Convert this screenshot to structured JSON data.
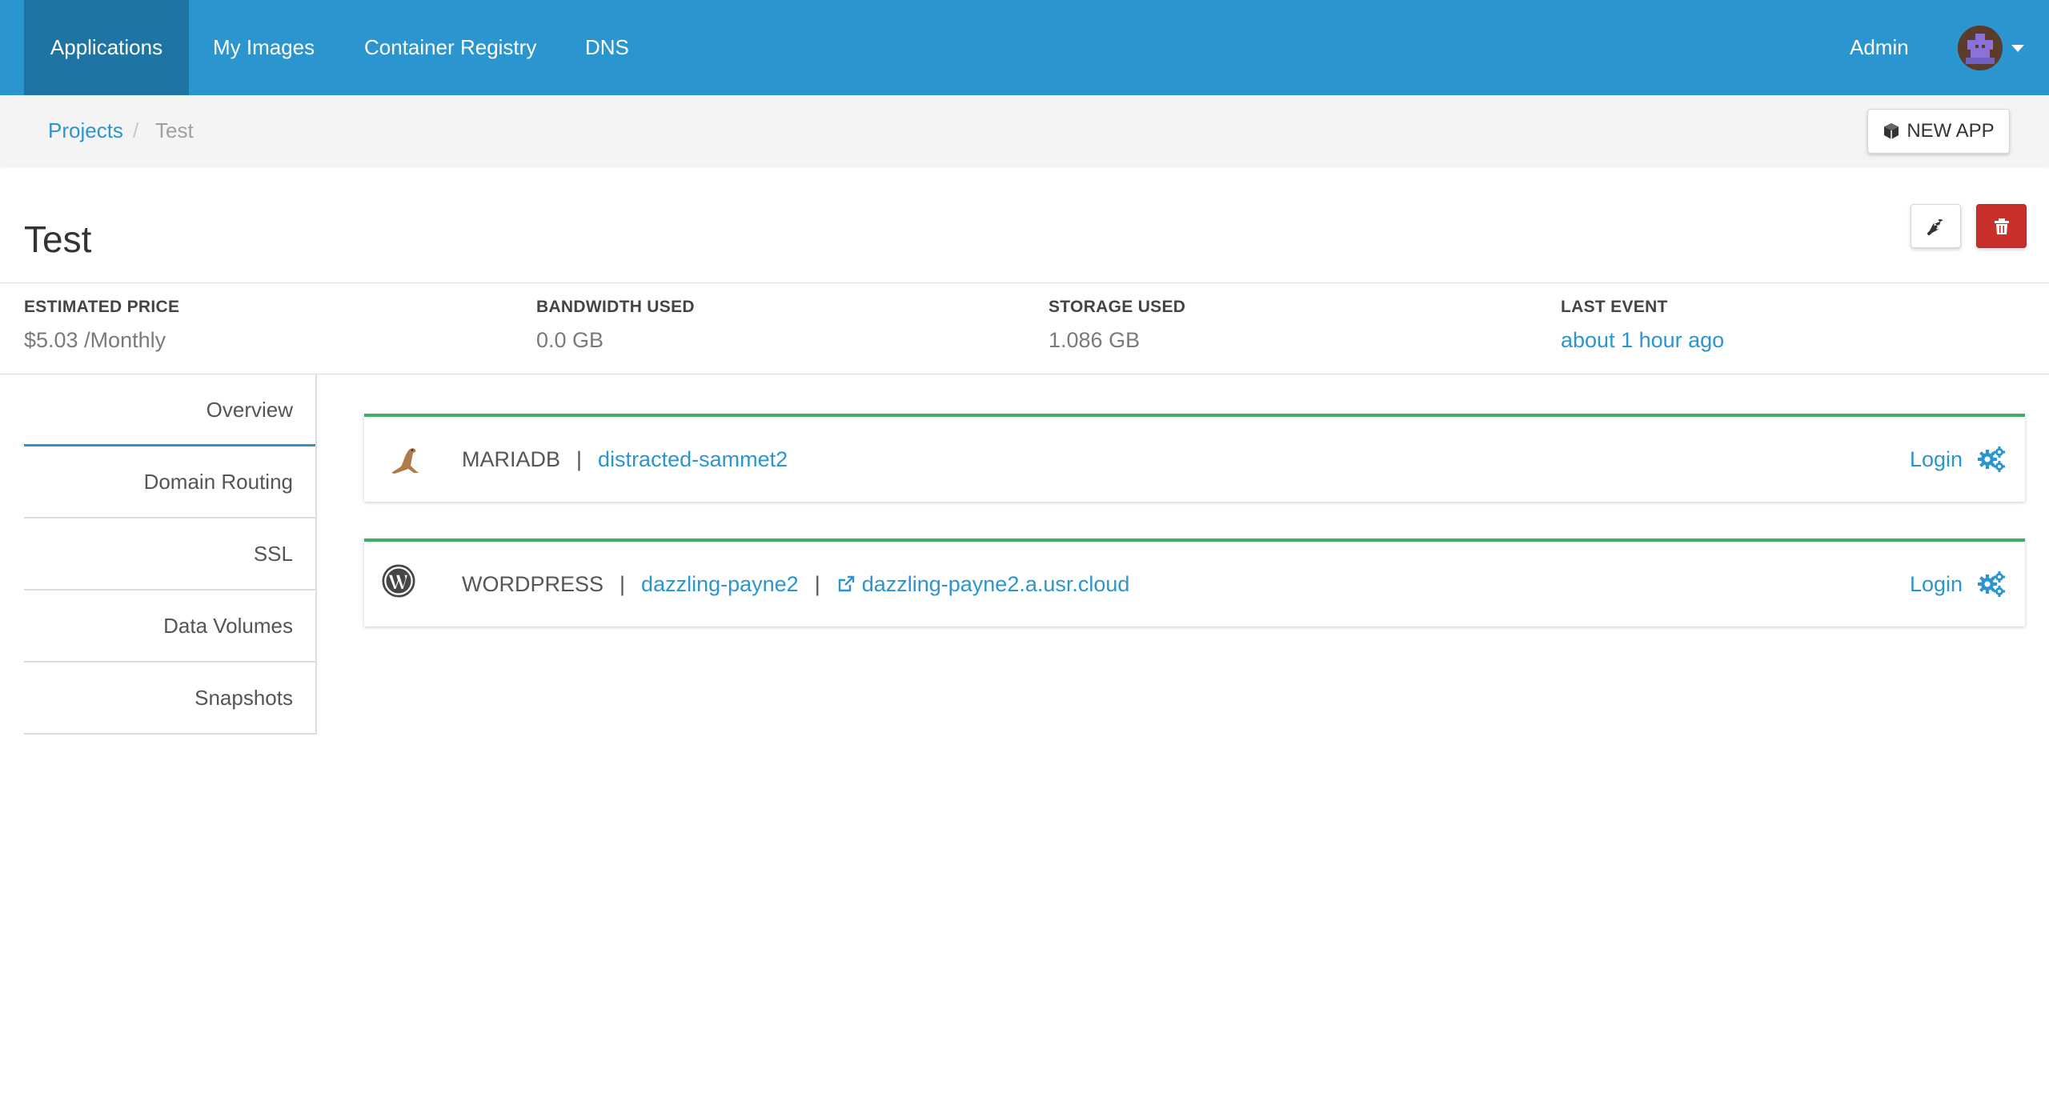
{
  "navbar": {
    "items": [
      {
        "label": "Applications",
        "active": true
      },
      {
        "label": "My Images",
        "active": false
      },
      {
        "label": "Container Registry",
        "active": false
      },
      {
        "label": "DNS",
        "active": false
      }
    ],
    "user_label": "Admin",
    "brand_color": "#2b95cf",
    "active_color": "#1e74a3"
  },
  "breadcrumb": {
    "items": [
      "Projects",
      "Test"
    ],
    "separator": "/"
  },
  "toolbar": {
    "new_app_label": "NEW APP",
    "new_app_icon": "cube-icon",
    "settings_icon": "wrench-icon",
    "delete_icon": "trash-icon",
    "delete_color": "#c9302c"
  },
  "project": {
    "title": "Test"
  },
  "stats": {
    "price_label": "ESTIMATED PRICE",
    "price_value": "$5.03 /Monthly",
    "bandwidth_label": "BANDWIDTH USED",
    "bandwidth_value": "0.0 GB",
    "storage_label": "STORAGE USED",
    "storage_value": "1.086 GB",
    "event_label": "LAST EVENT",
    "event_value": "about 1 hour ago"
  },
  "tabs": [
    {
      "label": "Overview",
      "active": true
    },
    {
      "label": "Domain Routing",
      "active": false
    },
    {
      "label": "SSL",
      "active": false
    },
    {
      "label": "Data Volumes",
      "active": false
    },
    {
      "label": "Snapshots",
      "active": false
    }
  ],
  "apps": [
    {
      "type": "MARIADB",
      "name": "distracted-sammet2",
      "icon": "mariadb-seal-icon",
      "login_label": "Login",
      "status_color": "#3fae6a"
    },
    {
      "type": "WORDPRESS",
      "name": "dazzling-payne2",
      "url": "dazzling-payne2.a.usr.cloud",
      "icon": "wordpress-icon",
      "login_label": "Login",
      "status_color": "#3fae6a"
    }
  ],
  "separator": "|"
}
